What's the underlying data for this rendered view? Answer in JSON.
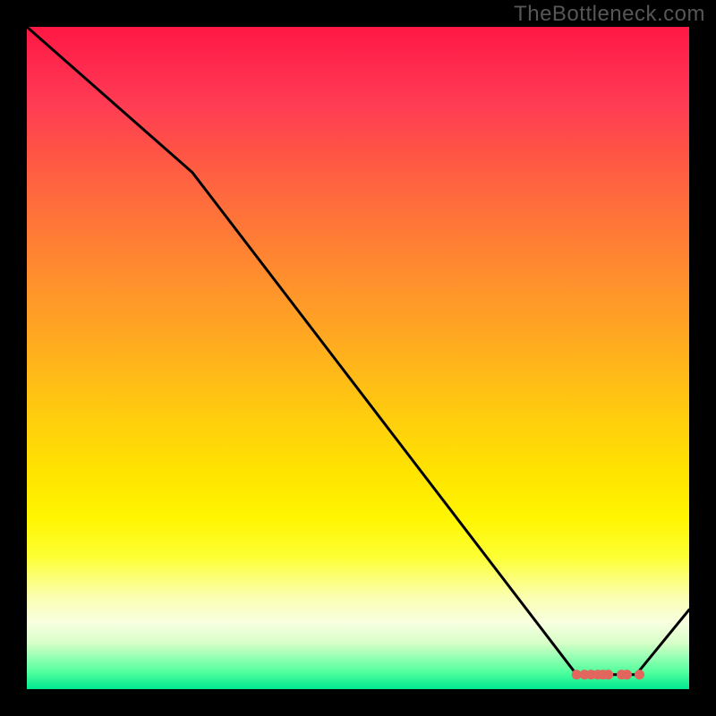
{
  "watermark": "TheBottleneck.com",
  "chart_data": {
    "type": "line",
    "title": "",
    "xlabel": "",
    "ylabel": "",
    "xlim": [
      0,
      100
    ],
    "ylim": [
      0,
      100
    ],
    "series": [
      {
        "name": "curve",
        "x": [
          0,
          25,
          83,
          88,
          92,
          100
        ],
        "values": [
          100,
          78,
          2.2,
          2.2,
          2.2,
          12
        ]
      }
    ],
    "markers": {
      "name": "bottom-cluster",
      "color": "#e2665d",
      "points": [
        {
          "x": 83.0,
          "y": 2.2
        },
        {
          "x": 84.2,
          "y": 2.2
        },
        {
          "x": 85.2,
          "y": 2.2
        },
        {
          "x": 86.2,
          "y": 2.2
        },
        {
          "x": 87.0,
          "y": 2.2
        },
        {
          "x": 87.8,
          "y": 2.2
        },
        {
          "x": 89.8,
          "y": 2.2
        },
        {
          "x": 90.6,
          "y": 2.2
        },
        {
          "x": 92.5,
          "y": 2.2
        }
      ]
    },
    "gradient_stops": [
      {
        "pos": 0,
        "color": "#ff1744"
      },
      {
        "pos": 50,
        "color": "#ffbb17"
      },
      {
        "pos": 80,
        "color": "#fdff33"
      },
      {
        "pos": 100,
        "color": "#00e890"
      }
    ]
  }
}
